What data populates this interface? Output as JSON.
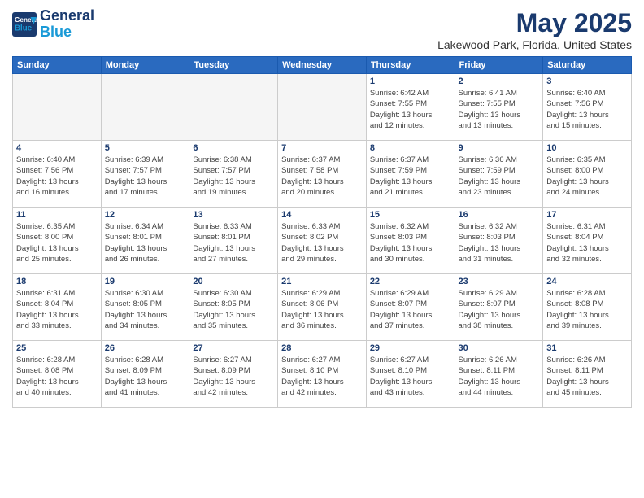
{
  "header": {
    "logo_line1": "General",
    "logo_line2": "Blue",
    "month_year": "May 2025",
    "location": "Lakewood Park, Florida, United States"
  },
  "weekdays": [
    "Sunday",
    "Monday",
    "Tuesday",
    "Wednesday",
    "Thursday",
    "Friday",
    "Saturday"
  ],
  "weeks": [
    [
      {
        "day": "",
        "info": ""
      },
      {
        "day": "",
        "info": ""
      },
      {
        "day": "",
        "info": ""
      },
      {
        "day": "",
        "info": ""
      },
      {
        "day": "1",
        "info": "Sunrise: 6:42 AM\nSunset: 7:55 PM\nDaylight: 13 hours\nand 12 minutes."
      },
      {
        "day": "2",
        "info": "Sunrise: 6:41 AM\nSunset: 7:55 PM\nDaylight: 13 hours\nand 13 minutes."
      },
      {
        "day": "3",
        "info": "Sunrise: 6:40 AM\nSunset: 7:56 PM\nDaylight: 13 hours\nand 15 minutes."
      }
    ],
    [
      {
        "day": "4",
        "info": "Sunrise: 6:40 AM\nSunset: 7:56 PM\nDaylight: 13 hours\nand 16 minutes."
      },
      {
        "day": "5",
        "info": "Sunrise: 6:39 AM\nSunset: 7:57 PM\nDaylight: 13 hours\nand 17 minutes."
      },
      {
        "day": "6",
        "info": "Sunrise: 6:38 AM\nSunset: 7:57 PM\nDaylight: 13 hours\nand 19 minutes."
      },
      {
        "day": "7",
        "info": "Sunrise: 6:37 AM\nSunset: 7:58 PM\nDaylight: 13 hours\nand 20 minutes."
      },
      {
        "day": "8",
        "info": "Sunrise: 6:37 AM\nSunset: 7:59 PM\nDaylight: 13 hours\nand 21 minutes."
      },
      {
        "day": "9",
        "info": "Sunrise: 6:36 AM\nSunset: 7:59 PM\nDaylight: 13 hours\nand 23 minutes."
      },
      {
        "day": "10",
        "info": "Sunrise: 6:35 AM\nSunset: 8:00 PM\nDaylight: 13 hours\nand 24 minutes."
      }
    ],
    [
      {
        "day": "11",
        "info": "Sunrise: 6:35 AM\nSunset: 8:00 PM\nDaylight: 13 hours\nand 25 minutes."
      },
      {
        "day": "12",
        "info": "Sunrise: 6:34 AM\nSunset: 8:01 PM\nDaylight: 13 hours\nand 26 minutes."
      },
      {
        "day": "13",
        "info": "Sunrise: 6:33 AM\nSunset: 8:01 PM\nDaylight: 13 hours\nand 27 minutes."
      },
      {
        "day": "14",
        "info": "Sunrise: 6:33 AM\nSunset: 8:02 PM\nDaylight: 13 hours\nand 29 minutes."
      },
      {
        "day": "15",
        "info": "Sunrise: 6:32 AM\nSunset: 8:03 PM\nDaylight: 13 hours\nand 30 minutes."
      },
      {
        "day": "16",
        "info": "Sunrise: 6:32 AM\nSunset: 8:03 PM\nDaylight: 13 hours\nand 31 minutes."
      },
      {
        "day": "17",
        "info": "Sunrise: 6:31 AM\nSunset: 8:04 PM\nDaylight: 13 hours\nand 32 minutes."
      }
    ],
    [
      {
        "day": "18",
        "info": "Sunrise: 6:31 AM\nSunset: 8:04 PM\nDaylight: 13 hours\nand 33 minutes."
      },
      {
        "day": "19",
        "info": "Sunrise: 6:30 AM\nSunset: 8:05 PM\nDaylight: 13 hours\nand 34 minutes."
      },
      {
        "day": "20",
        "info": "Sunrise: 6:30 AM\nSunset: 8:05 PM\nDaylight: 13 hours\nand 35 minutes."
      },
      {
        "day": "21",
        "info": "Sunrise: 6:29 AM\nSunset: 8:06 PM\nDaylight: 13 hours\nand 36 minutes."
      },
      {
        "day": "22",
        "info": "Sunrise: 6:29 AM\nSunset: 8:07 PM\nDaylight: 13 hours\nand 37 minutes."
      },
      {
        "day": "23",
        "info": "Sunrise: 6:29 AM\nSunset: 8:07 PM\nDaylight: 13 hours\nand 38 minutes."
      },
      {
        "day": "24",
        "info": "Sunrise: 6:28 AM\nSunset: 8:08 PM\nDaylight: 13 hours\nand 39 minutes."
      }
    ],
    [
      {
        "day": "25",
        "info": "Sunrise: 6:28 AM\nSunset: 8:08 PM\nDaylight: 13 hours\nand 40 minutes."
      },
      {
        "day": "26",
        "info": "Sunrise: 6:28 AM\nSunset: 8:09 PM\nDaylight: 13 hours\nand 41 minutes."
      },
      {
        "day": "27",
        "info": "Sunrise: 6:27 AM\nSunset: 8:09 PM\nDaylight: 13 hours\nand 42 minutes."
      },
      {
        "day": "28",
        "info": "Sunrise: 6:27 AM\nSunset: 8:10 PM\nDaylight: 13 hours\nand 42 minutes."
      },
      {
        "day": "29",
        "info": "Sunrise: 6:27 AM\nSunset: 8:10 PM\nDaylight: 13 hours\nand 43 minutes."
      },
      {
        "day": "30",
        "info": "Sunrise: 6:26 AM\nSunset: 8:11 PM\nDaylight: 13 hours\nand 44 minutes."
      },
      {
        "day": "31",
        "info": "Sunrise: 6:26 AM\nSunset: 8:11 PM\nDaylight: 13 hours\nand 45 minutes."
      }
    ]
  ]
}
